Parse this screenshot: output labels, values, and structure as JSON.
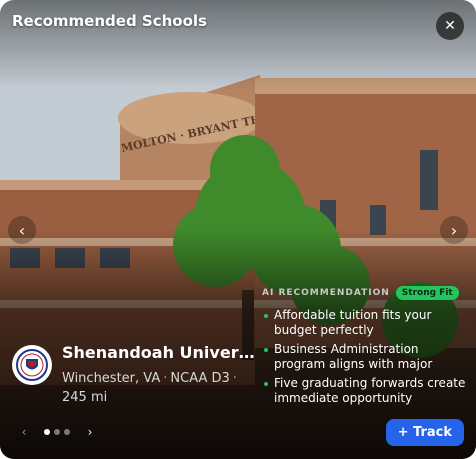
{
  "header": {
    "title": "Recommended Schools",
    "close_icon": "close-icon"
  },
  "carousel": {
    "prev_icon": "chevron-left-icon",
    "next_icon": "chevron-right-icon"
  },
  "photo": {
    "sign_text": "MOLTON · BRYANT THEATRE"
  },
  "school": {
    "name": "Shenandoah University",
    "location": "Winchester, VA",
    "division": "NCAA D3",
    "distance": "245 mi",
    "logo_icon": "university-seal-icon"
  },
  "ai": {
    "label": "AI RECOMMENDATION",
    "badge": "Strong Fit",
    "badge_color": "#22c55e",
    "reasons": [
      "Affordable tuition fits your budget perfectly",
      "Business Administration program aligns with major",
      "Five graduating forwards create immediate opportunity"
    ]
  },
  "pager": {
    "prev": "‹",
    "next": "›",
    "pages": 3,
    "current": 1
  },
  "actions": {
    "track_label": "+ Track",
    "track_color": "#2563eb"
  }
}
